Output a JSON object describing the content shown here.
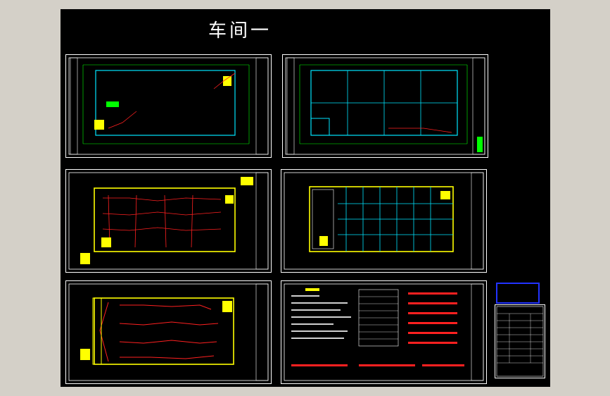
{
  "canvas": {
    "title": "车间一",
    "background": "#000000"
  },
  "sheets": [
    {
      "name": "sheet-site-plan",
      "kind": "site-plan"
    },
    {
      "name": "sheet-grid-plan",
      "kind": "grid-plan"
    },
    {
      "name": "sheet-lighting-plan",
      "kind": "lighting-plan"
    },
    {
      "name": "sheet-layout-plan",
      "kind": "layout-plan"
    },
    {
      "name": "sheet-power-plan",
      "kind": "power-plan"
    },
    {
      "name": "sheet-design-notes",
      "kind": "notes"
    }
  ],
  "stamp": {
    "label": "",
    "sublabel": ""
  },
  "colors": {
    "frame": "#ffffff",
    "grid": "#00e5ff",
    "axis": "#00ff00",
    "wall": "#ffff00",
    "wire": "#ff2020",
    "stamp_border": "#2233ff"
  }
}
